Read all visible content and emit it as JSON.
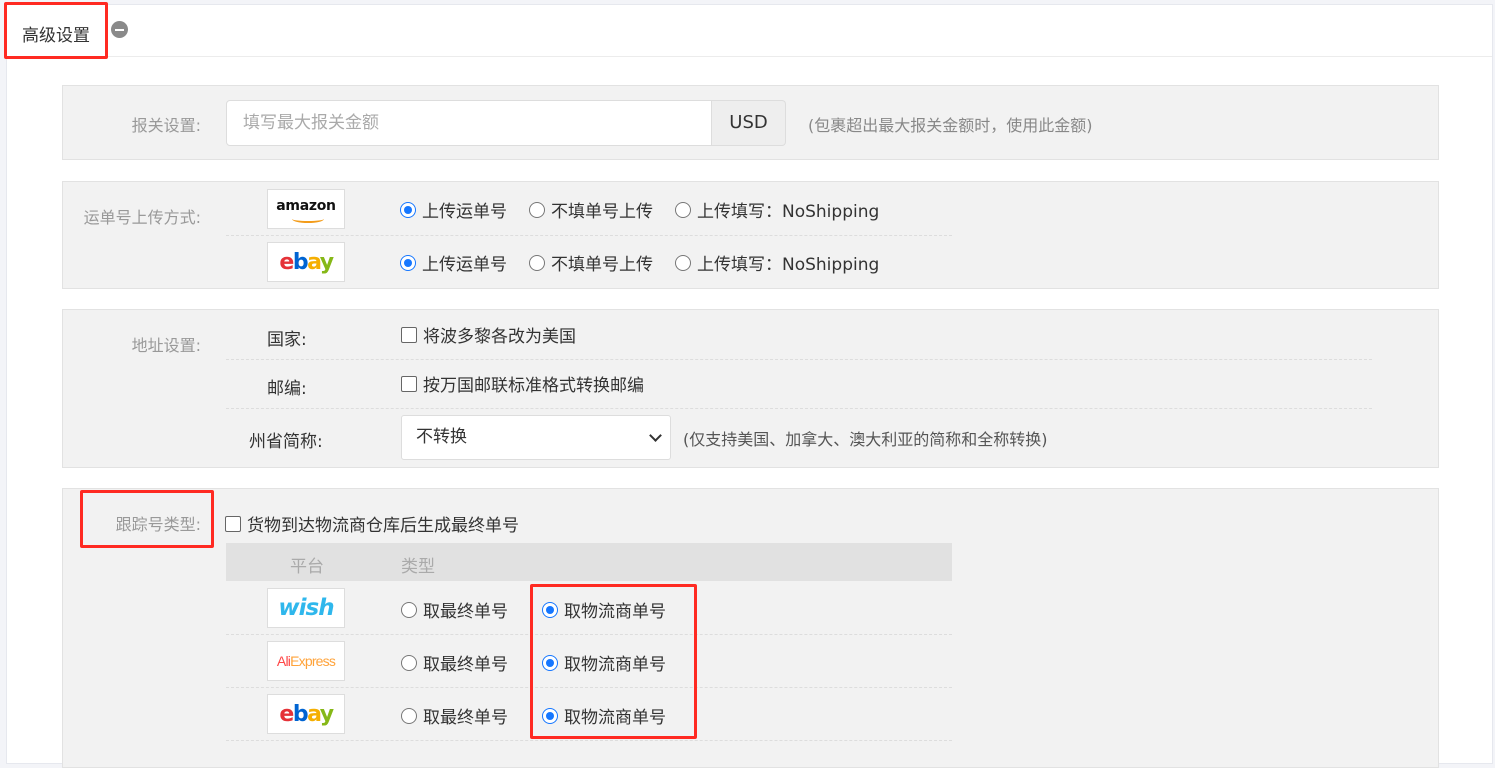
{
  "header": {
    "title": "高级设置"
  },
  "declare": {
    "label": "报关设置:",
    "placeholder": "填写最大报关金额",
    "currency": "USD",
    "hint": "(包裹超出最大报关金额时，使用此金额)"
  },
  "upload": {
    "label": "运单号上传方式:",
    "rows": [
      {
        "platform": "amazon",
        "options": [
          "上传运单号",
          "不填单号上传",
          "上传填写：NoShipping"
        ],
        "selected": 0
      },
      {
        "platform": "ebay",
        "options": [
          "上传运单号",
          "不填单号上传",
          "上传填写：NoShipping"
        ],
        "selected": 0
      }
    ]
  },
  "address": {
    "label": "地址设置:",
    "country_label": "国家:",
    "country_option": "将波多黎各改为美国",
    "zip_label": "邮编:",
    "zip_option": "按万国邮联标准格式转换邮编",
    "state_label": "州省简称:",
    "state_value": "不转换",
    "state_hint": "(仅支持美国、加拿大、澳大利亚的简称和全称转换)"
  },
  "tracking": {
    "label": "跟踪号类型:",
    "checkbox": "货物到达物流商仓库后生成最终单号",
    "col_platform": "平台",
    "col_type": "类型",
    "rows": [
      {
        "platform": "wish",
        "options": [
          "取最终单号",
          "取物流商单号"
        ],
        "selected": 1
      },
      {
        "platform": "aliexpress",
        "options": [
          "取最终单号",
          "取物流商单号"
        ],
        "selected": 1
      },
      {
        "platform": "ebay",
        "options": [
          "取最终单号",
          "取物流商单号"
        ],
        "selected": 1
      }
    ]
  },
  "logos": {
    "amazon": "amazon",
    "ebay": [
      "e",
      "b",
      "a",
      "y"
    ],
    "wish": "wish",
    "aliexpress": [
      "Ali",
      "Express"
    ]
  },
  "colors": {
    "accent": "#1677ff",
    "highlight": "#ff2a22"
  }
}
